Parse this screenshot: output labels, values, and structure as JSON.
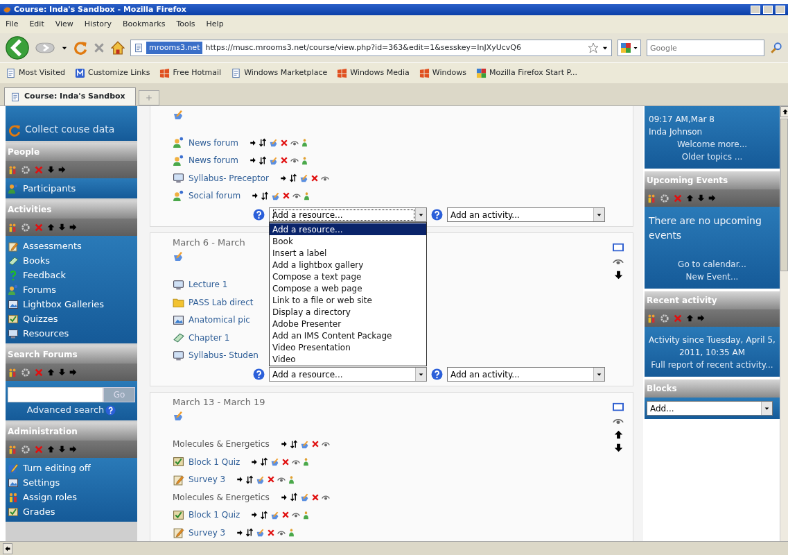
{
  "window": {
    "title": "Course: Inda's Sandbox - Mozilla Firefox"
  },
  "menu": [
    "File",
    "Edit",
    "View",
    "History",
    "Bookmarks",
    "Tools",
    "Help"
  ],
  "address": {
    "site": "mrooms3.net",
    "url": "https://musc.mrooms3.net/course/view.php?id=363&edit=1&sesskey=InJXyUcvQ6"
  },
  "search": {
    "placeholder": "Google"
  },
  "bookmarks": [
    {
      "label": "Most Visited",
      "kind": "page"
    },
    {
      "label": "Customize Links",
      "kind": "customize"
    },
    {
      "label": "Free Hotmail",
      "kind": "windows"
    },
    {
      "label": "Windows Marketplace",
      "kind": "page"
    },
    {
      "label": "Windows Media",
      "kind": "windows"
    },
    {
      "label": "Windows",
      "kind": "windows"
    },
    {
      "label": "Mozilla Firefox Start P...",
      "kind": "google"
    }
  ],
  "tabs": [
    {
      "label": "Course: Inda's Sandbox",
      "selected": true
    }
  ],
  "left_sidebar": {
    "top_link": "Collect couse data",
    "blocks": [
      {
        "title": "People",
        "kind": "list",
        "can_move_up": false,
        "can_move_down": true,
        "can_move_right": true,
        "items": [
          {
            "label": "Participants",
            "kind": "people"
          }
        ]
      },
      {
        "title": "Activities",
        "kind": "list",
        "can_move_up": true,
        "can_move_down": true,
        "can_move_right": true,
        "items": [
          {
            "label": "Assessments",
            "kind": "note"
          },
          {
            "label": "Books",
            "kind": "book"
          },
          {
            "label": "Feedback",
            "kind": "help"
          },
          {
            "label": "Forums",
            "kind": "forum"
          },
          {
            "label": "Lightbox Galleries",
            "kind": "picture"
          },
          {
            "label": "Quizzes",
            "kind": "quiz"
          },
          {
            "label": "Resources",
            "kind": "monitor"
          }
        ]
      },
      {
        "title": "Search Forums",
        "kind": "search",
        "can_move_up": true,
        "can_move_down": true,
        "can_move_right": true,
        "button": "Go",
        "link": "Advanced search"
      },
      {
        "title": "Administration",
        "kind": "list",
        "can_move_up": true,
        "can_move_down": true,
        "can_move_right": true,
        "items": [
          {
            "label": "Turn editing off",
            "kind": "edit"
          },
          {
            "label": "Settings",
            "kind": "picture"
          },
          {
            "label": "Assign roles",
            "kind": "roles"
          },
          {
            "label": "Grades",
            "kind": "quiz"
          }
        ]
      }
    ]
  },
  "sections": [
    {
      "items": [
        {
          "label": "News forum",
          "kind": "forum",
          "controls_visible": true,
          "groupmode": true
        },
        {
          "label": "News forum",
          "kind": "forum",
          "controls_visible": true,
          "groupmode": true
        },
        {
          "label": "Syllabus- Preceptor",
          "kind": "monitor",
          "controls_visible": true,
          "groupmode": false
        },
        {
          "label": "Social forum",
          "kind": "forum",
          "controls_visible": true,
          "groupmode": true
        }
      ],
      "add_resource": {
        "value": "Add a resource...",
        "expanded": true,
        "options": [
          {
            "label": "Add a resource...",
            "selected": true
          },
          {
            "label": "Book",
            "selected": false
          },
          {
            "label": "Insert a label",
            "selected": false
          },
          {
            "label": "Add a lightbox gallery",
            "selected": false
          },
          {
            "label": "Compose a text page",
            "selected": false
          },
          {
            "label": "Compose a web page",
            "selected": false
          },
          {
            "label": "Link to a file or web site",
            "selected": false
          },
          {
            "label": "Display a directory",
            "selected": false
          },
          {
            "label": "Adobe Presenter",
            "selected": false
          },
          {
            "label": "Add an IMS Content Package",
            "selected": false
          },
          {
            "label": "Video Presentation",
            "selected": false
          },
          {
            "label": "Video",
            "selected": false
          }
        ]
      },
      "add_activity": {
        "value": "Add an activity..."
      }
    },
    {
      "title": "March 6 - March",
      "controls": {
        "can_move_up": false,
        "can_move_down": true
      },
      "items": [
        {
          "label": "Lecture 1",
          "kind": "monitor",
          "controls_visible": false
        },
        {
          "label": "PASS Lab direct",
          "kind": "folder",
          "controls_visible": false
        },
        {
          "label": "Anatomical pic",
          "kind": "picture",
          "controls_visible": false
        },
        {
          "label": "Chapter 1",
          "kind": "book",
          "controls_visible": false
        },
        {
          "label": "Syllabus- Studen",
          "kind": "monitor",
          "controls_visible": false
        }
      ],
      "add_resource": {
        "value": "Add a resource...",
        "expanded": false
      },
      "add_activity": {
        "value": "Add an activity..."
      }
    },
    {
      "title": "March 13 - March 19",
      "controls": {
        "can_move_up": true,
        "can_move_down": true
      },
      "items": [
        {
          "label": "Molecules & Energetics",
          "kind": "label",
          "controls_visible": true,
          "groupmode": false
        },
        {
          "label": "Block 1 Quiz",
          "kind": "quiz",
          "controls_visible": true,
          "groupmode": true
        },
        {
          "label": "Survey 3",
          "kind": "note",
          "controls_visible": true,
          "groupmode": true
        },
        {
          "label": "Molecules & Energetics",
          "kind": "label",
          "controls_visible": true,
          "groupmode": false
        },
        {
          "label": "Block 1 Quiz",
          "kind": "quiz",
          "controls_visible": true,
          "groupmode": true
        },
        {
          "label": "Survey 3",
          "kind": "note",
          "controls_visible": true,
          "groupmode": true
        }
      ]
    }
  ],
  "right_sidebar": [
    {
      "editable": false,
      "lines": [
        {
          "kind": "text",
          "text": "09:17 AM,Mar 8"
        },
        {
          "kind": "text",
          "text": "Inda Johnson"
        },
        {
          "kind": "link",
          "text": "Welcome more..."
        },
        {
          "kind": "link",
          "text": "Older topics ..."
        }
      ]
    },
    {
      "title": "Upcoming Events",
      "editable": true,
      "can_move_up": true,
      "can_move_down": true,
      "can_move_right": true,
      "lines": [
        {
          "kind": "text",
          "text": "There are no upcoming events"
        },
        {
          "kind": "link",
          "text": "Go to calendar..."
        },
        {
          "kind": "link",
          "text": "New Event..."
        }
      ]
    },
    {
      "title": "Recent activity",
      "editable": true,
      "can_move_up": true,
      "can_move_down": false,
      "can_move_right": true,
      "lines": [
        {
          "kind": "note",
          "text": "Activity since Tuesday, April 5, 2011, 10:35 AM"
        },
        {
          "kind": "link",
          "text": "Full report of recent activity..."
        }
      ]
    },
    {
      "title": "Blocks",
      "editable": false,
      "select": "Add..."
    }
  ]
}
